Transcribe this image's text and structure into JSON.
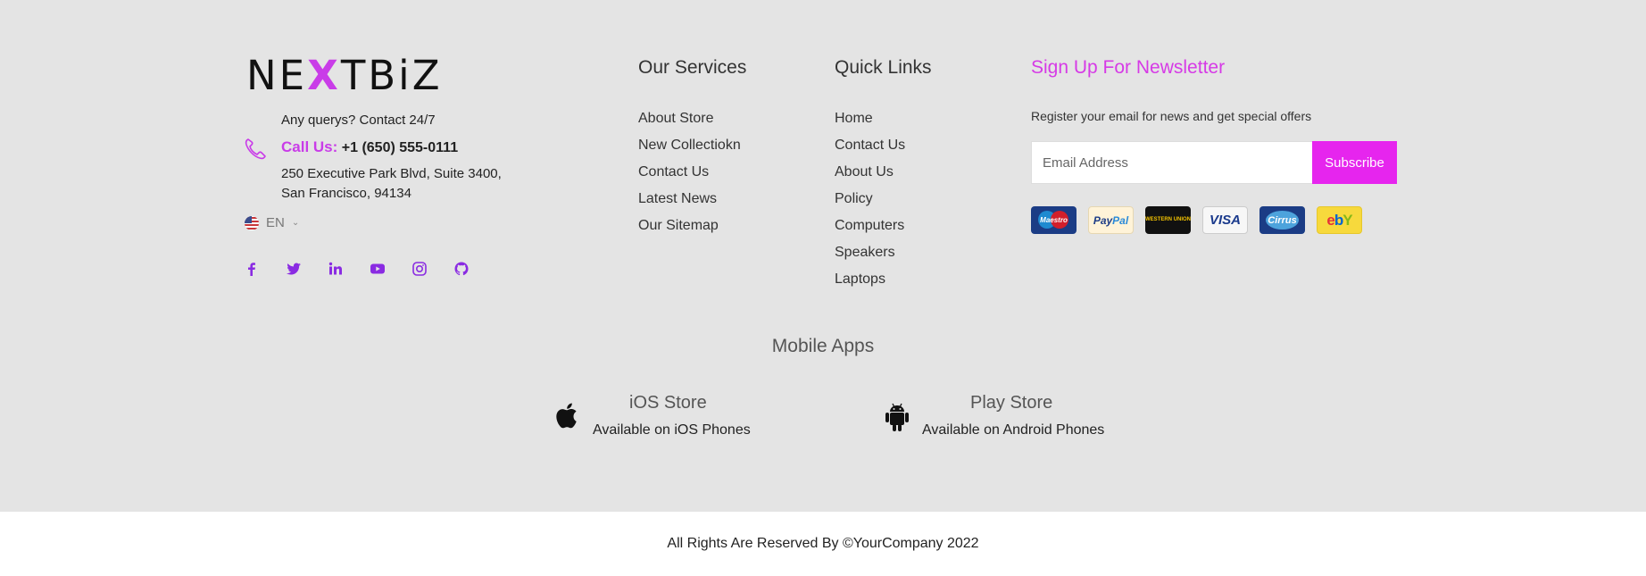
{
  "brand": {
    "logo_pre": "NE",
    "logo_x": "X",
    "logo_mid": "TB",
    "logo_i": "i",
    "logo_end": "Z",
    "tagline": "Any querys? Contact 24/7",
    "call_label": "Call Us:",
    "phone": "+1 (650) 555-0111",
    "address_line1": "250 Executive Park Blvd, Suite 3400,",
    "address_line2": "San Francisco, 94134",
    "language": "EN",
    "accent_color": "#c93ce8"
  },
  "social": [
    "facebook-icon",
    "twitter-icon",
    "linkedin-icon",
    "youtube-icon",
    "instagram-icon",
    "github-icon"
  ],
  "services": {
    "title": "Our Services",
    "items": [
      "About Store",
      "New Collectiokn",
      "Contact Us",
      "Latest News",
      "Our Sitemap"
    ]
  },
  "quick_links": {
    "title": "Quick Links",
    "items": [
      "Home",
      "Contact Us",
      "About Us",
      "Policy",
      "Computers",
      "Speakers",
      "Laptops"
    ]
  },
  "newsletter": {
    "title": "Sign Up For Newsletter",
    "text": "Register your email for news and get special offers",
    "placeholder": "Email Address",
    "button": "Subscribe",
    "button_color": "#e625ee"
  },
  "payment_cards": {
    "maestro": "Maestro",
    "paypal_a": "Pay",
    "paypal_b": "Pal",
    "western": "WESTERN UNION",
    "visa": "VISA",
    "cirrus": "Cirrus",
    "ebay": [
      "e",
      "b",
      "Y"
    ]
  },
  "apps": {
    "title": "Mobile Apps",
    "ios_name": "iOS Store",
    "ios_sub": "Available on iOS Phones",
    "android_name": "Play Store",
    "android_sub": "Available on Android Phones"
  },
  "footer": {
    "copyright": "All Rights Are Reserved By ©YourCompany 2022"
  }
}
